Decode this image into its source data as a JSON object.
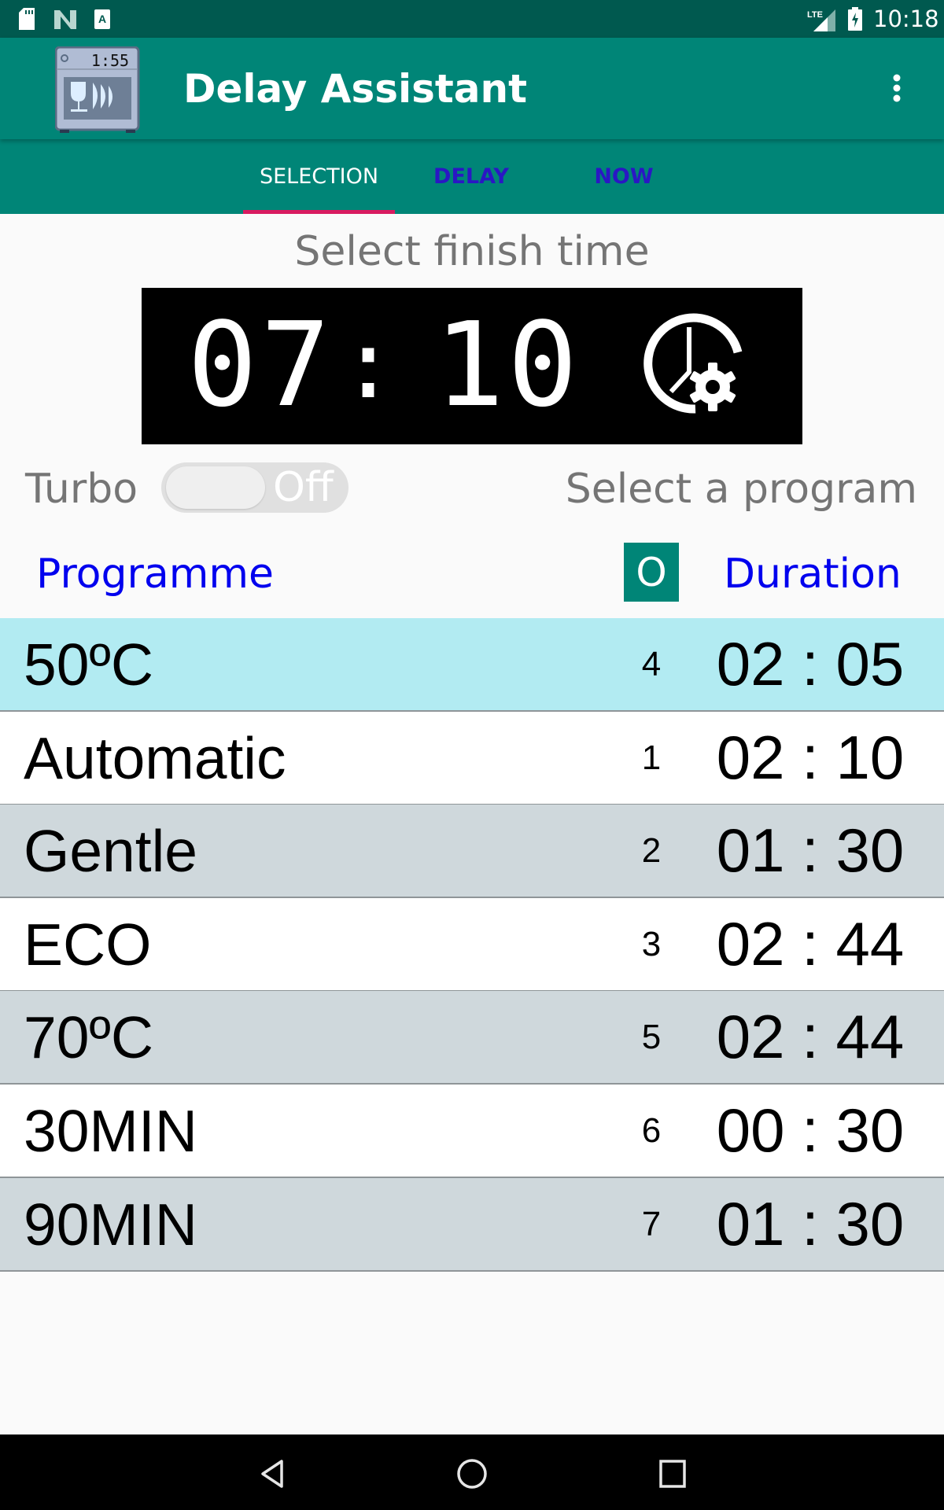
{
  "status_bar": {
    "time": "10:18",
    "network": "LTE",
    "left_icons": [
      "sd-card-icon",
      "n-notification-icon",
      "a-notification-icon"
    ],
    "right_icons": [
      "lte-signal-icon",
      "battery-charging-icon"
    ]
  },
  "app_bar": {
    "title": "Delay Assistant",
    "logo_display": "1:55",
    "overflow_icon": "more-vert-icon"
  },
  "tabs": [
    {
      "label": "SELECTION",
      "active": true
    },
    {
      "label": "DELAY",
      "active": false
    },
    {
      "label": "NOW",
      "active": false
    }
  ],
  "finish_time": {
    "label": "Select finish time",
    "hours": "07",
    "separator": ":",
    "minutes": "10",
    "icon": "clock-settings-icon"
  },
  "turbo": {
    "label": "Turbo",
    "state_label": "Off",
    "on": false
  },
  "hint": "Select a program",
  "table": {
    "header_programme": "Programme",
    "header_badge": "O",
    "header_duration": "Duration",
    "rows": [
      {
        "name": "50ºC",
        "num": "4",
        "duration": "02 : 05",
        "selected": true
      },
      {
        "name": "Automatic",
        "num": "1",
        "duration": "02 : 10",
        "selected": false
      },
      {
        "name": "Gentle",
        "num": "2",
        "duration": "01 : 30",
        "selected": false
      },
      {
        "name": "ECO",
        "num": "3",
        "duration": "02 : 44",
        "selected": false
      },
      {
        "name": "70ºC",
        "num": "5",
        "duration": "02 : 44",
        "selected": false
      },
      {
        "name": "30MIN",
        "num": "6",
        "duration": "00 : 30",
        "selected": false
      },
      {
        "name": "90MIN",
        "num": "7",
        "duration": "01 : 30",
        "selected": false
      }
    ]
  },
  "colors": {
    "primary": "#008577",
    "primary_dark": "#00594f",
    "accent": "#d81b60",
    "selected_row": "#b2ebf2",
    "alt_row": "#cfd8dc",
    "header_text": "#0000ee",
    "inactive_tab": "#2a17c4"
  },
  "nav_bar": {
    "icons": [
      "back-icon",
      "home-icon",
      "recents-icon"
    ]
  }
}
